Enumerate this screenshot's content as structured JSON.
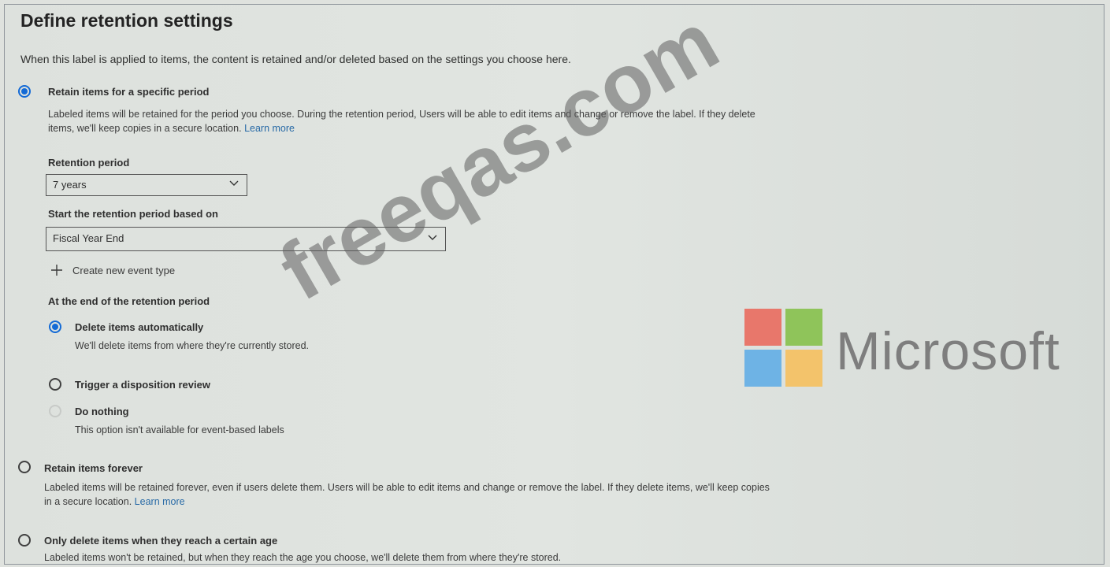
{
  "header": {
    "title": "Define retention settings",
    "subtitle": "When this label is applied to items, the content is retained and/or deleted based on the settings you choose here."
  },
  "retain_specific": {
    "title": "Retain items for a specific period",
    "desc_line1": "Labeled items will be retained for the period you choose. During the retention period, Users will be able to edit items and change or remove the label. If they delete",
    "desc_line2": "items, we'll keep copies in a secure location.",
    "learn_more": "Learn more",
    "checked": true
  },
  "retention_period": {
    "label": "Retention period",
    "value": "7 years"
  },
  "start_based_on": {
    "label": "Start the retention period based on",
    "value": "Fiscal Year End"
  },
  "create_event": {
    "label": "Create new event type"
  },
  "end_of_period": {
    "label": "At the end of the retention period",
    "delete_auto": {
      "title": "Delete items automatically",
      "desc": "We'll delete items from where they're currently stored.",
      "checked": true
    },
    "disposition": {
      "title": "Trigger a disposition review",
      "checked": false
    },
    "do_nothing": {
      "title": "Do nothing",
      "desc": "This option isn't available for event-based labels",
      "disabled": true
    }
  },
  "retain_forever": {
    "title": "Retain items forever",
    "desc_line1": "Labeled items will be retained forever, even if users delete them. Users will be able to edit items and change or remove the label. If they delete items, we'll keep copies",
    "desc_line2": "in a secure location.",
    "learn_more": "Learn more",
    "checked": false
  },
  "only_delete": {
    "title": "Only delete items when they reach a certain age",
    "desc": "Labeled items won't be retained, but when they reach the age you choose, we'll delete them from where they're stored.",
    "checked": false
  },
  "watermark": {
    "text": "freeqas.com"
  },
  "logo": {
    "text": "Microsoft",
    "colors": [
      "#f25022",
      "#7fba00",
      "#00a4ef",
      "#ffb900"
    ]
  },
  "colors": {
    "accent": "#136ad6",
    "link": "#286aa6"
  }
}
